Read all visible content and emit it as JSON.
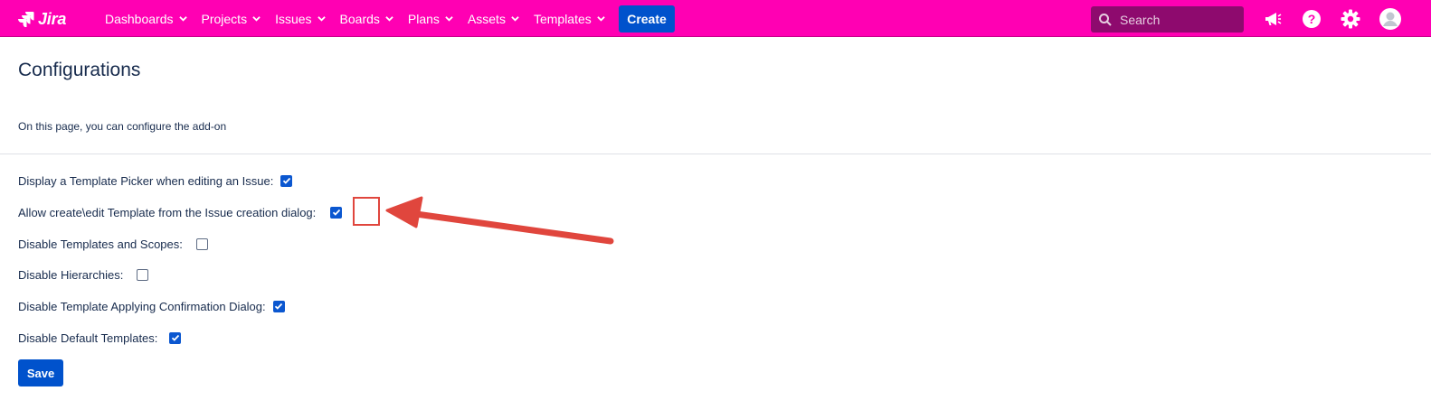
{
  "header": {
    "logo_text": "Jira",
    "nav_items": [
      {
        "label": "Dashboards"
      },
      {
        "label": "Projects"
      },
      {
        "label": "Issues"
      },
      {
        "label": "Boards"
      },
      {
        "label": "Plans"
      },
      {
        "label": "Assets"
      },
      {
        "label": "Templates"
      }
    ],
    "create_label": "Create",
    "search_placeholder": "Search",
    "icons": [
      "megaphone-icon",
      "help-icon",
      "settings-gear-icon",
      "user-avatar-icon"
    ]
  },
  "main": {
    "title": "Configurations",
    "description": "On this page, you can configure the add-on",
    "options": [
      {
        "label": "Display a Template Picker when editing an Issue:",
        "checked": true
      },
      {
        "label": "Allow create\\edit Template from the Issue creation dialog:",
        "checked": true
      },
      {
        "label": "Disable Templates and Scopes:",
        "checked": false
      },
      {
        "label": "Disable Hierarchies:",
        "checked": false
      },
      {
        "label": "Disable Template Applying Confirmation Dialog:",
        "checked": true
      },
      {
        "label": "Disable Default Templates:",
        "checked": true
      }
    ],
    "save_label": "Save"
  },
  "colors": {
    "topbar": "#ff00b3",
    "primary_button": "#0052cc",
    "annotation": "#e0463d"
  }
}
